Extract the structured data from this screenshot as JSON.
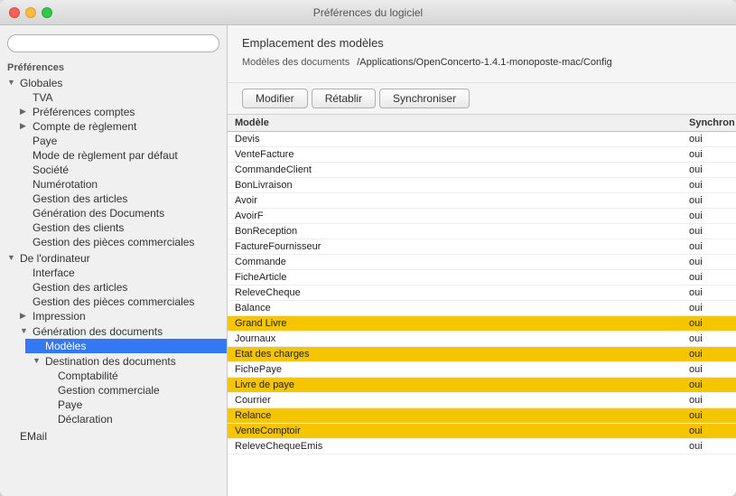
{
  "window": {
    "title": "Préférences du logiciel"
  },
  "sidebar": {
    "search_placeholder": "",
    "sections": [
      {
        "label": "Préférences",
        "items": [
          {
            "label": "Globales",
            "expanded": true,
            "children": [
              {
                "label": "TVA",
                "children": []
              },
              {
                "label": "Préférences comptes",
                "expanded": false,
                "children": [
                  "placeholder"
                ]
              },
              {
                "label": "Compte de règlement",
                "expanded": false,
                "children": [
                  "placeholder"
                ]
              },
              {
                "label": "Paye",
                "children": []
              },
              {
                "label": "Mode de règlement par défaut",
                "children": []
              },
              {
                "label": "Société",
                "children": []
              },
              {
                "label": "Numérotation",
                "children": []
              },
              {
                "label": "Gestion des articles",
                "children": []
              },
              {
                "label": "Génération des Documents",
                "children": []
              },
              {
                "label": "Gestion des clients",
                "children": []
              },
              {
                "label": "Gestion des pièces commerciales",
                "children": []
              }
            ]
          },
          {
            "label": "De l'ordinateur",
            "expanded": true,
            "children": [
              {
                "label": "Interface",
                "children": []
              },
              {
                "label": "Gestion des articles",
                "children": []
              },
              {
                "label": "Gestion des pièces commerciales",
                "children": []
              },
              {
                "label": "Impression",
                "expanded": false,
                "children": [
                  "placeholder"
                ]
              },
              {
                "label": "Génération des documents",
                "expanded": true,
                "children": [
                  {
                    "label": "Modèles",
                    "selected": true,
                    "children": []
                  },
                  {
                    "label": "Destination des documents",
                    "expanded": true,
                    "children": [
                      {
                        "label": "Comptabilité",
                        "children": []
                      },
                      {
                        "label": "Gestion commerciale",
                        "children": []
                      },
                      {
                        "label": "Paye",
                        "children": []
                      },
                      {
                        "label": "Déclaration",
                        "children": []
                      }
                    ]
                  }
                ]
              }
            ]
          },
          {
            "label": "EMail",
            "children": []
          }
        ]
      }
    ]
  },
  "main": {
    "section_title": "Emplacement des modèles",
    "path_label": "Modèles des documents",
    "path_value": "/Applications/OpenConcerto-1.4.1-monoposte-mac/Config",
    "buttons": {
      "modifier": "Modifier",
      "retablir": "Rétablir",
      "synchroniser": "Synchroniser"
    },
    "table": {
      "headers": [
        "Modèle",
        "Synchron"
      ],
      "rows": [
        {
          "name": "Devis",
          "sync": "oui",
          "highlighted": false
        },
        {
          "name": "VenteFacture",
          "sync": "oui",
          "highlighted": false
        },
        {
          "name": "CommandeClient",
          "sync": "oui",
          "highlighted": false
        },
        {
          "name": "BonLivraison",
          "sync": "oui",
          "highlighted": false
        },
        {
          "name": "Avoir",
          "sync": "oui",
          "highlighted": false
        },
        {
          "name": "AvoirF",
          "sync": "oui",
          "highlighted": false
        },
        {
          "name": "BonReception",
          "sync": "oui",
          "highlighted": false
        },
        {
          "name": "FactureFournisseur",
          "sync": "oui",
          "highlighted": false
        },
        {
          "name": "Commande",
          "sync": "oui",
          "highlighted": false
        },
        {
          "name": "FicheArticle",
          "sync": "oui",
          "highlighted": false
        },
        {
          "name": "ReleveCheque",
          "sync": "oui",
          "highlighted": false
        },
        {
          "name": "Balance",
          "sync": "oui",
          "highlighted": false
        },
        {
          "name": "Grand Livre",
          "sync": "oui",
          "highlighted": true
        },
        {
          "name": "Journaux",
          "sync": "oui",
          "highlighted": false
        },
        {
          "name": "Etat des charges",
          "sync": "oui",
          "highlighted": true
        },
        {
          "name": "FichePaye",
          "sync": "oui",
          "highlighted": false
        },
        {
          "name": "Livre de paye",
          "sync": "oui",
          "highlighted": true
        },
        {
          "name": "Courrier",
          "sync": "oui",
          "highlighted": false
        },
        {
          "name": "Relance",
          "sync": "oui",
          "highlighted": true
        },
        {
          "name": "VenteComptoir",
          "sync": "oui",
          "highlighted": true
        },
        {
          "name": "ReleveChequeEmis",
          "sync": "oui",
          "highlighted": false
        }
      ]
    }
  }
}
